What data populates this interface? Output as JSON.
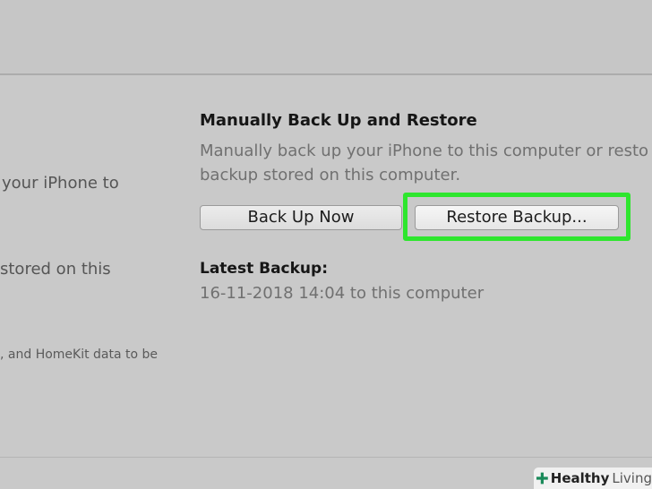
{
  "left_panel": {
    "line1": "your iPhone to",
    "line2": "stored on this",
    "line3": ", and HomeKit data to be"
  },
  "backup_section": {
    "title": "Manually Back Up and Restore",
    "description_line1": "Manually back up your iPhone to this computer or resto",
    "description_line2": "backup stored on this computer.",
    "back_up_now_label": "Back Up Now",
    "restore_backup_label": "Restore Backup...",
    "latest_backup_title": "Latest Backup:",
    "latest_backup_value": "16-11-2018 14:04 to this computer"
  },
  "watermark": {
    "brand_bold": "Healthy",
    "brand_light": "Living",
    "icon": "plus-cross-icon",
    "color": "#1a8a5a"
  },
  "highlight_color": "#2ee62e"
}
